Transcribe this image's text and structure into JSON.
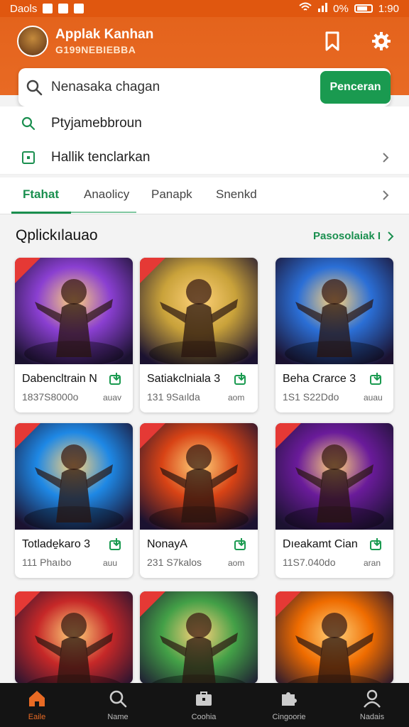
{
  "status_bar": {
    "left_text": "Daols",
    "battery_text": "0%",
    "time": "1:90"
  },
  "header": {
    "title": "Applak Kanhan",
    "subtitle": "G199NEBIEBBA"
  },
  "search": {
    "value": "Nenasaka chagan",
    "button_label": "Penceran"
  },
  "suggestions": [
    {
      "label": "Ptyjamebbroun",
      "icon": "search-icon"
    },
    {
      "label": "Hallik tenclarkan",
      "icon": "square-icon"
    }
  ],
  "tabs": [
    {
      "label": "Ftahat",
      "active": true
    },
    {
      "label": "Anaolicy",
      "active": false
    },
    {
      "label": "Panapk",
      "active": false
    },
    {
      "label": "Snenkd",
      "active": false
    }
  ],
  "section": {
    "title": "Qplickılauao",
    "link": "Pasosolaiak I"
  },
  "games": [
    {
      "name": "Dabencltrain N",
      "meta": "1837S8000o",
      "meta2": "auav",
      "accent": "#8a3fd1"
    },
    {
      "name": "Satiakclniala 3",
      "meta": "131 9Saılda",
      "meta2": "aom",
      "accent": "#c9a23a"
    },
    {
      "name": "Beha Crarce 3",
      "meta": "1S1 S22Ddo",
      "meta2": "auau",
      "accent": "#2b6fd6"
    },
    {
      "name": "Totlade̱karo 3",
      "meta": "111 Phaıbo",
      "meta2": "auu",
      "accent": "#1e88e5"
    },
    {
      "name": "NonayA",
      "meta": "231 S7kalos",
      "meta2": "aom",
      "accent": "#d84315"
    },
    {
      "name": "Dıeakamt Cian",
      "meta": "11S7.040do",
      "meta2": "aran",
      "accent": "#6a1b9a"
    },
    {
      "name": "",
      "meta": "",
      "meta2": "",
      "accent": "#c62828"
    },
    {
      "name": "",
      "meta": "",
      "meta2": "",
      "accent": "#43a047"
    },
    {
      "name": "",
      "meta": "",
      "meta2": "",
      "accent": "#ef6c00"
    }
  ],
  "bottom_nav": [
    {
      "label": "Eaile",
      "icon": "home-icon",
      "active": true
    },
    {
      "label": "Name",
      "icon": "search-icon",
      "active": false
    },
    {
      "label": "Coohia",
      "icon": "briefcase-icon",
      "active": false
    },
    {
      "label": "Cingoorie",
      "icon": "puzzle-icon",
      "active": false
    },
    {
      "label": "Nadais",
      "icon": "user-icon",
      "active": false
    }
  ],
  "colors": {
    "brand_orange": "#e4631c",
    "accent_green": "#1a9a50",
    "nav_background": "#141414"
  }
}
